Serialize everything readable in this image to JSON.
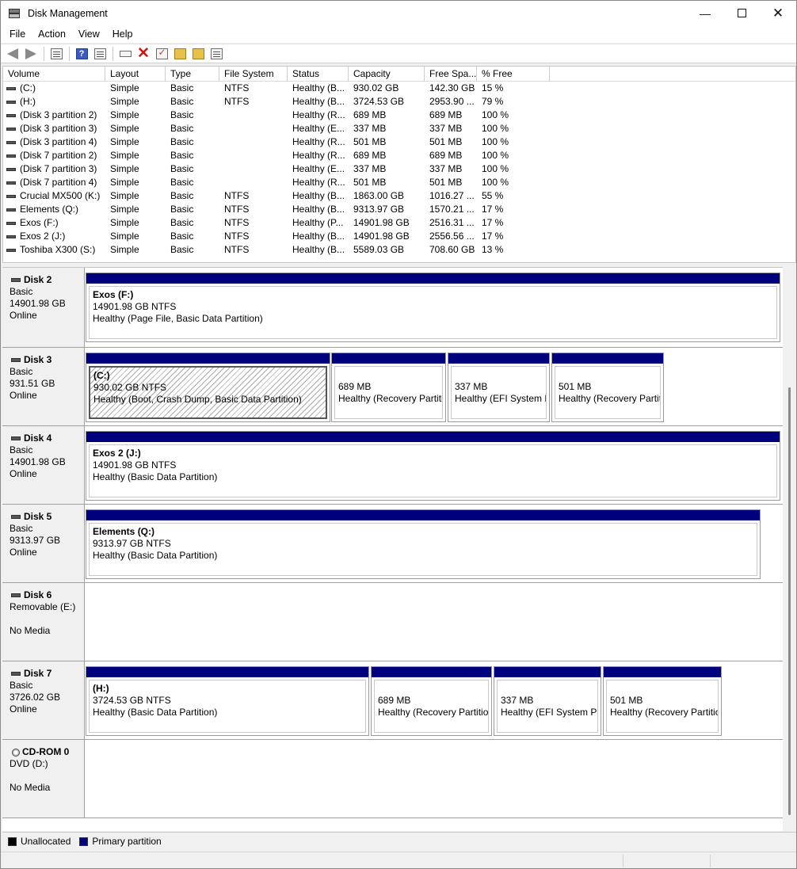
{
  "window": {
    "title": "Disk Management"
  },
  "menu": [
    "File",
    "Action",
    "View",
    "Help"
  ],
  "toolbar": {
    "icons": [
      "back-icon",
      "forward-icon",
      "show-hide-console-tree-icon",
      "help-icon",
      "properties-icon",
      "connect-icon",
      "delete-icon",
      "check-icon",
      "folder-up-icon",
      "find-icon",
      "list-icon"
    ]
  },
  "volume_table": {
    "headers": [
      "Volume",
      "Layout",
      "Type",
      "File System",
      "Status",
      "Capacity",
      "Free Spa...",
      "% Free"
    ],
    "rows": [
      [
        "(C:)",
        "Simple",
        "Basic",
        "NTFS",
        "Healthy (B...",
        "930.02 GB",
        "142.30 GB",
        "15 %"
      ],
      [
        "(H:)",
        "Simple",
        "Basic",
        "NTFS",
        "Healthy (B...",
        "3724.53 GB",
        "2953.90 ...",
        "79 %"
      ],
      [
        "(Disk 3 partition 2)",
        "Simple",
        "Basic",
        "",
        "Healthy (R...",
        "689 MB",
        "689 MB",
        "100 %"
      ],
      [
        "(Disk 3 partition 3)",
        "Simple",
        "Basic",
        "",
        "Healthy (E...",
        "337 MB",
        "337 MB",
        "100 %"
      ],
      [
        "(Disk 3 partition 4)",
        "Simple",
        "Basic",
        "",
        "Healthy (R...",
        "501 MB",
        "501 MB",
        "100 %"
      ],
      [
        "(Disk 7 partition 2)",
        "Simple",
        "Basic",
        "",
        "Healthy (R...",
        "689 MB",
        "689 MB",
        "100 %"
      ],
      [
        "(Disk 7 partition 3)",
        "Simple",
        "Basic",
        "",
        "Healthy (E...",
        "337 MB",
        "337 MB",
        "100 %"
      ],
      [
        "(Disk 7 partition 4)",
        "Simple",
        "Basic",
        "",
        "Healthy (R...",
        "501 MB",
        "501 MB",
        "100 %"
      ],
      [
        "Crucial MX500 (K:)",
        "Simple",
        "Basic",
        "NTFS",
        "Healthy (B...",
        "1863.00 GB",
        "1016.27 ...",
        "55 %"
      ],
      [
        "Elements (Q:)",
        "Simple",
        "Basic",
        "NTFS",
        "Healthy (B...",
        "9313.97 GB",
        "1570.21 ...",
        "17 %"
      ],
      [
        "Exos (F:)",
        "Simple",
        "Basic",
        "NTFS",
        "Healthy (P...",
        "14901.98 GB",
        "2516.31 ...",
        "17 %"
      ],
      [
        "Exos 2 (J:)",
        "Simple",
        "Basic",
        "NTFS",
        "Healthy (B...",
        "14901.98 GB",
        "2556.56 ...",
        "17 %"
      ],
      [
        "Toshiba X300 (S:)",
        "Simple",
        "Basic",
        "NTFS",
        "Healthy (B...",
        "5589.03 GB",
        "708.60 GB",
        "13 %"
      ]
    ]
  },
  "disks": [
    {
      "name": "Disk 2",
      "type": "Basic",
      "size": "14901.98 GB",
      "state": "Online",
      "partitions": [
        {
          "name": "Exos  (F:)",
          "line2": "14901.98 GB NTFS",
          "line3": "Healthy (Page File, Basic Data Partition)"
        }
      ]
    },
    {
      "name": "Disk 3",
      "type": "Basic",
      "size": "931.51 GB",
      "state": "Online",
      "partitions": [
        {
          "name": "(C:)",
          "line2": "930.02 GB NTFS",
          "line3": "Healthy (Boot, Crash Dump, Basic Data Partition)"
        },
        {
          "name": "",
          "line2": "689 MB",
          "line3": "Healthy (Recovery Partition)"
        },
        {
          "name": "",
          "line2": "337 MB",
          "line3": "Healthy (EFI System Partition)"
        },
        {
          "name": "",
          "line2": "501 MB",
          "line3": "Healthy (Recovery Partition)"
        }
      ]
    },
    {
      "name": "Disk 4",
      "type": "Basic",
      "size": "14901.98 GB",
      "state": "Online",
      "partitions": [
        {
          "name": "Exos 2  (J:)",
          "line2": "14901.98 GB NTFS",
          "line3": "Healthy (Basic Data Partition)"
        }
      ]
    },
    {
      "name": "Disk 5",
      "type": "Basic",
      "size": "9313.97 GB",
      "state": "Online",
      "partitions": [
        {
          "name": "Elements  (Q:)",
          "line2": "9313.97 GB NTFS",
          "line3": "Healthy (Basic Data Partition)"
        }
      ]
    },
    {
      "name": "Disk 6",
      "type": "Removable (E:)",
      "size": "",
      "state": "No Media",
      "partitions": []
    },
    {
      "name": "Disk 7",
      "type": "Basic",
      "size": "3726.02 GB",
      "state": "Online",
      "partitions": [
        {
          "name": "(H:)",
          "line2": "3724.53 GB NTFS",
          "line3": "Healthy (Basic Data Partition)"
        },
        {
          "name": "",
          "line2": "689 MB",
          "line3": "Healthy (Recovery Partition)"
        },
        {
          "name": "",
          "line2": "337 MB",
          "line3": "Healthy (EFI System Partition)"
        },
        {
          "name": "",
          "line2": "501 MB",
          "line3": "Healthy (Recovery Partition)"
        }
      ]
    },
    {
      "name": "CD-ROM 0",
      "type": "DVD (D:)",
      "size": "",
      "state": "No Media",
      "partitions": []
    }
  ],
  "legend": {
    "unallocated": "Unallocated",
    "primary": "Primary partition"
  },
  "colors": {
    "primary_partition": "#00007f",
    "unallocated": "#000000"
  }
}
